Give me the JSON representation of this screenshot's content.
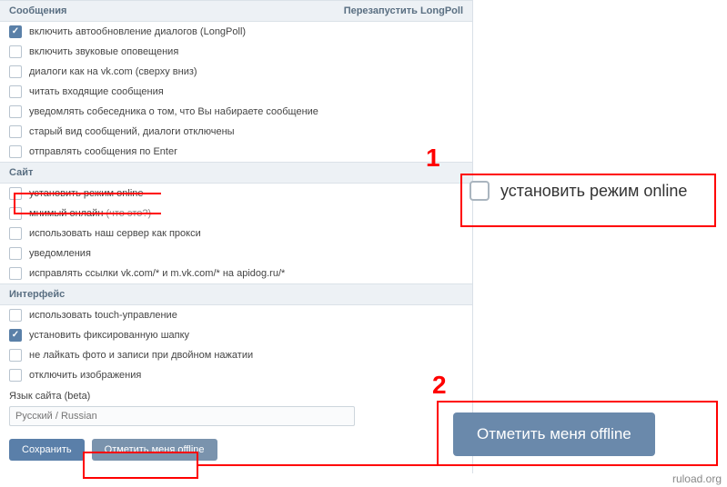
{
  "sections": {
    "messages": {
      "title": "Сообщения",
      "restart": "Перезапустить LongPoll",
      "items": [
        {
          "label": "включить автообновление диалогов (LongPoll)",
          "checked": true
        },
        {
          "label": "включить звуковые оповещения",
          "checked": false
        },
        {
          "label": "диалоги как на vk.com (сверху вниз)",
          "checked": false
        },
        {
          "label": "читать входящие сообщения",
          "checked": false
        },
        {
          "label": "уведомлять собеседника о том, что Вы набираете сообщение",
          "checked": false
        },
        {
          "label": "старый вид сообщений, диалоги отключены",
          "checked": false
        },
        {
          "label": "отправлять сообщения по Enter",
          "checked": false
        }
      ]
    },
    "site": {
      "title": "Сайт",
      "items": [
        {
          "label": "установить режим online",
          "checked": false
        },
        {
          "label": "мнимый онлайн",
          "sub": "(что это?)",
          "checked": false
        },
        {
          "label": "использовать наш сервер как прокси",
          "checked": false
        },
        {
          "label": "уведомления",
          "checked": false
        },
        {
          "label": "исправлять ссылки vk.com/* и m.vk.com/* на apidog.ru/*",
          "checked": false
        }
      ]
    },
    "interface": {
      "title": "Интерфейс",
      "items": [
        {
          "label": "использовать touch-управление",
          "checked": false
        },
        {
          "label": "установить фиксированную шапку",
          "checked": true
        },
        {
          "label": "не лайкать фото и записи при двойном нажатии",
          "checked": false
        },
        {
          "label": "отключить изображения",
          "checked": false
        }
      ],
      "lang_label": "Язык сайта (beta)",
      "lang_placeholder": "Русский / Russian"
    }
  },
  "buttons": {
    "save": "Сохранить",
    "offline_small": "Отметить меня offline",
    "offline_big": "Отметить меня offline"
  },
  "callouts": {
    "n1": "1",
    "n2": "2",
    "zoom_text": "установить режим online"
  },
  "watermark": "ruload.org"
}
